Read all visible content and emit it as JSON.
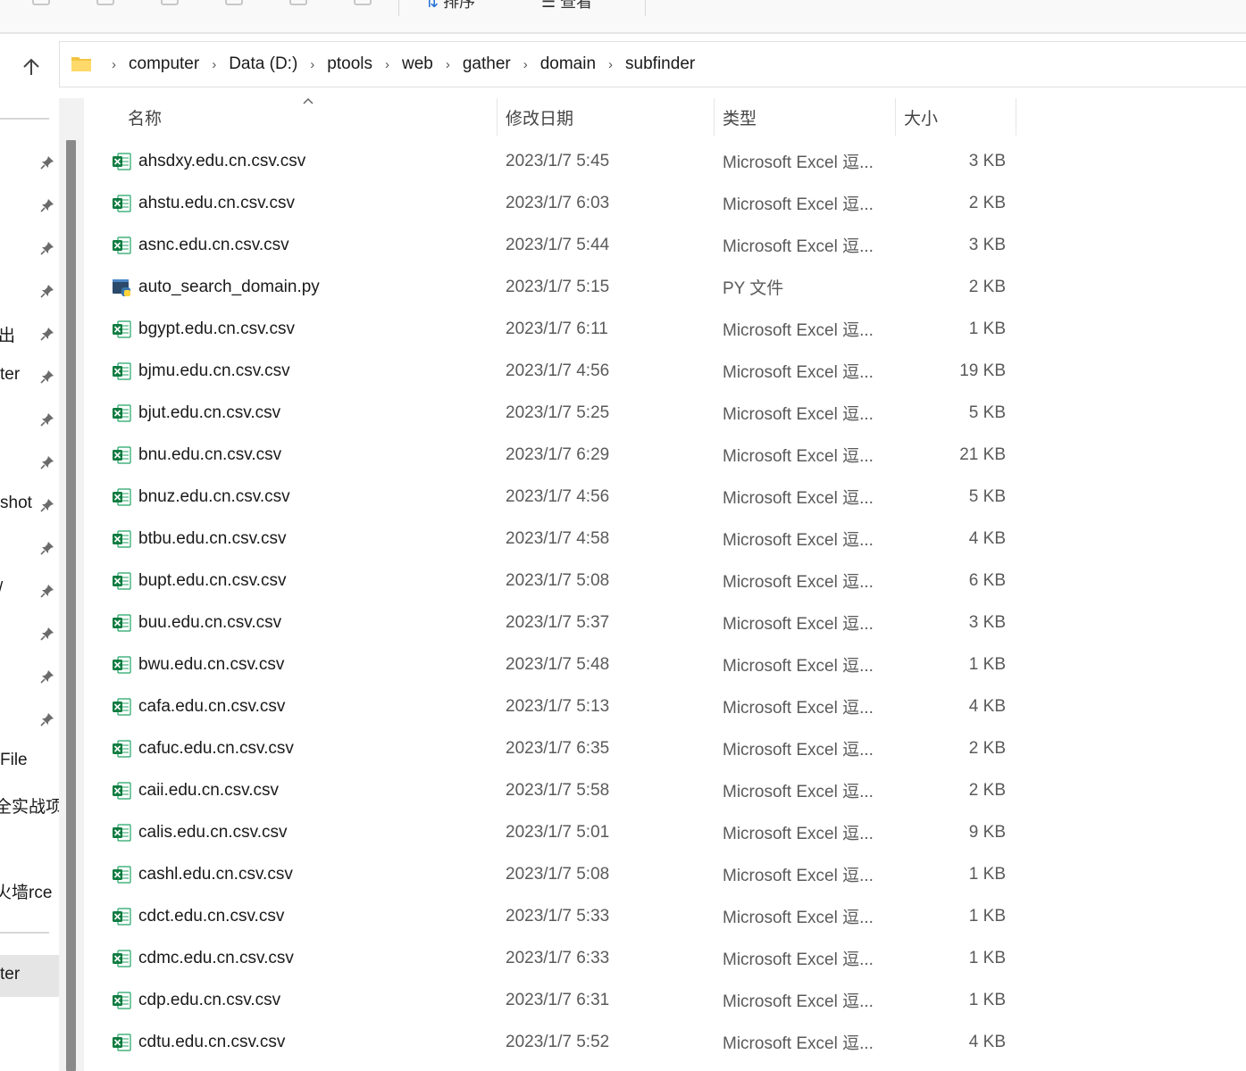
{
  "toolbar": {
    "sort_label": "排序",
    "view_label": "查看"
  },
  "address": {
    "crumbs": [
      "computer",
      "Data (D:)",
      "ptools",
      "web",
      "gather",
      "domain",
      "subfinder"
    ]
  },
  "nav": {
    "labels": [
      "出",
      "ter",
      "shot",
      "/",
      "File",
      "全实战项",
      "火墙rce",
      "ter"
    ]
  },
  "columns": {
    "name": "名称",
    "date": "修改日期",
    "type": "类型",
    "size": "大小"
  },
  "files": [
    {
      "name": "ahsdxy.edu.cn.csv.csv",
      "date": "2023/1/7 5:45",
      "type": "Microsoft Excel 逗...",
      "size": "3 KB",
      "icon": "excel-icon"
    },
    {
      "name": "ahstu.edu.cn.csv.csv",
      "date": "2023/1/7 6:03",
      "type": "Microsoft Excel 逗...",
      "size": "2 KB",
      "icon": "excel-icon"
    },
    {
      "name": "asnc.edu.cn.csv.csv",
      "date": "2023/1/7 5:44",
      "type": "Microsoft Excel 逗...",
      "size": "3 KB",
      "icon": "excel-icon"
    },
    {
      "name": "auto_search_domain.py",
      "date": "2023/1/7 5:15",
      "type": "PY 文件",
      "size": "2 KB",
      "icon": "python-icon"
    },
    {
      "name": "bgypt.edu.cn.csv.csv",
      "date": "2023/1/7 6:11",
      "type": "Microsoft Excel 逗...",
      "size": "1 KB",
      "icon": "excel-icon"
    },
    {
      "name": "bjmu.edu.cn.csv.csv",
      "date": "2023/1/7 4:56",
      "type": "Microsoft Excel 逗...",
      "size": "19 KB",
      "icon": "excel-icon"
    },
    {
      "name": "bjut.edu.cn.csv.csv",
      "date": "2023/1/7 5:25",
      "type": "Microsoft Excel 逗...",
      "size": "5 KB",
      "icon": "excel-icon"
    },
    {
      "name": "bnu.edu.cn.csv.csv",
      "date": "2023/1/7 6:29",
      "type": "Microsoft Excel 逗...",
      "size": "21 KB",
      "icon": "excel-icon"
    },
    {
      "name": "bnuz.edu.cn.csv.csv",
      "date": "2023/1/7 4:56",
      "type": "Microsoft Excel 逗...",
      "size": "5 KB",
      "icon": "excel-icon"
    },
    {
      "name": "btbu.edu.cn.csv.csv",
      "date": "2023/1/7 4:58",
      "type": "Microsoft Excel 逗...",
      "size": "4 KB",
      "icon": "excel-icon"
    },
    {
      "name": "bupt.edu.cn.csv.csv",
      "date": "2023/1/7 5:08",
      "type": "Microsoft Excel 逗...",
      "size": "6 KB",
      "icon": "excel-icon"
    },
    {
      "name": "buu.edu.cn.csv.csv",
      "date": "2023/1/7 5:37",
      "type": "Microsoft Excel 逗...",
      "size": "3 KB",
      "icon": "excel-icon"
    },
    {
      "name": "bwu.edu.cn.csv.csv",
      "date": "2023/1/7 5:48",
      "type": "Microsoft Excel 逗...",
      "size": "1 KB",
      "icon": "excel-icon"
    },
    {
      "name": "cafa.edu.cn.csv.csv",
      "date": "2023/1/7 5:13",
      "type": "Microsoft Excel 逗...",
      "size": "4 KB",
      "icon": "excel-icon"
    },
    {
      "name": "cafuc.edu.cn.csv.csv",
      "date": "2023/1/7 6:35",
      "type": "Microsoft Excel 逗...",
      "size": "2 KB",
      "icon": "excel-icon"
    },
    {
      "name": "caii.edu.cn.csv.csv",
      "date": "2023/1/7 5:58",
      "type": "Microsoft Excel 逗...",
      "size": "2 KB",
      "icon": "excel-icon"
    },
    {
      "name": "calis.edu.cn.csv.csv",
      "date": "2023/1/7 5:01",
      "type": "Microsoft Excel 逗...",
      "size": "9 KB",
      "icon": "excel-icon"
    },
    {
      "name": "cashl.edu.cn.csv.csv",
      "date": "2023/1/7 5:08",
      "type": "Microsoft Excel 逗...",
      "size": "1 KB",
      "icon": "excel-icon"
    },
    {
      "name": "cdct.edu.cn.csv.csv",
      "date": "2023/1/7 5:33",
      "type": "Microsoft Excel 逗...",
      "size": "1 KB",
      "icon": "excel-icon"
    },
    {
      "name": "cdmc.edu.cn.csv.csv",
      "date": "2023/1/7 6:33",
      "type": "Microsoft Excel 逗...",
      "size": "1 KB",
      "icon": "excel-icon"
    },
    {
      "name": "cdp.edu.cn.csv.csv",
      "date": "2023/1/7 6:31",
      "type": "Microsoft Excel 逗...",
      "size": "1 KB",
      "icon": "excel-icon"
    },
    {
      "name": "cdtu.edu.cn.csv.csv",
      "date": "2023/1/7 5:52",
      "type": "Microsoft Excel 逗...",
      "size": "4 KB",
      "icon": "excel-icon"
    }
  ]
}
